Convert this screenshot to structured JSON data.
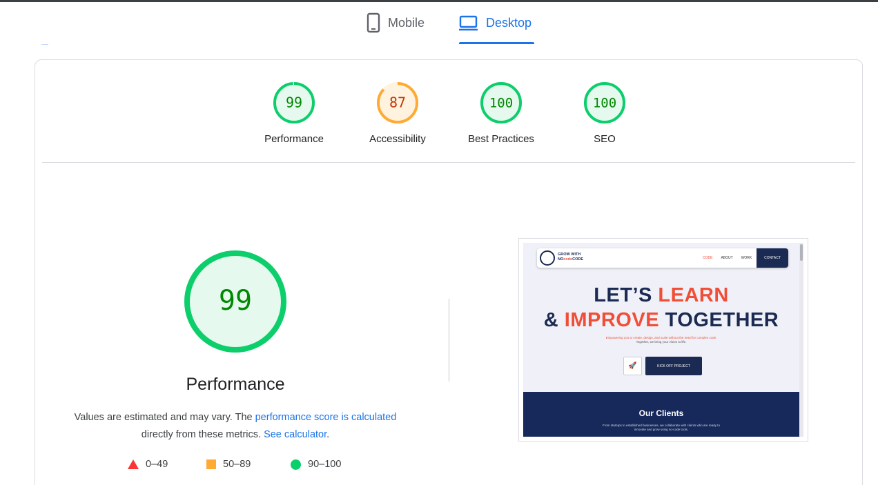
{
  "tabs": [
    {
      "label": "Mobile",
      "icon": "mobile-icon",
      "selected": false
    },
    {
      "label": "Desktop",
      "icon": "desktop-icon",
      "selected": true
    }
  ],
  "categories": [
    {
      "label": "Performance",
      "score": "99",
      "status": "pass"
    },
    {
      "label": "Accessibility",
      "score": "87",
      "status": "average"
    },
    {
      "label": "Best Practices",
      "score": "100",
      "status": "pass"
    },
    {
      "label": "SEO",
      "score": "100",
      "status": "pass"
    }
  ],
  "main": {
    "score": "99",
    "title": "Performance",
    "desc_prefix": "Values are estimated and may vary. The ",
    "desc_link1": "performance score is calculated",
    "desc_middle": " directly from these metrics. ",
    "desc_link2": "See calculator",
    "desc_suffix": "."
  },
  "legend": [
    {
      "range": "0–49",
      "icon": "fail-triangle-icon"
    },
    {
      "range": "50–89",
      "icon": "average-square-icon"
    },
    {
      "range": "90–100",
      "icon": "pass-circle-icon"
    }
  ],
  "screenshot": {
    "logo_line1": "GROW WITH",
    "logo_line2_a": "NO",
    "logo_line2_b": "code",
    "logo_line2_c": "CODE",
    "nav_links": [
      "CODE",
      "ABOUT",
      "WORK"
    ],
    "contact": "CONTACT",
    "headline_1a": "LET’S ",
    "headline_1b": "LEARN",
    "headline_2a": "& ",
    "headline_2b": "IMPROVE",
    "headline_2c": " TOGETHER",
    "sub_a": "Empowering you to ",
    "sub_b": "create, design, and scale",
    "sub_c": " without the need for complex code.",
    "sub_line2": "Together, we bring your vision to life.",
    "cta": "KICK OFF PROJECT",
    "clients_title": "Our Clients",
    "clients_sub_1": "From startups to established businesses, we collaborate with clients who are ready to",
    "clients_sub_2": "innovate and grow using no-code tools."
  },
  "colors": {
    "pass": "#0cce6b",
    "pass_text": "#008800",
    "pass_bg": "#e6f9ef",
    "average": "#ffaa33",
    "average_text": "#c33300",
    "average_bg": "#fff3e0",
    "fail": "#ff3333",
    "accent": "#1a73e8"
  }
}
